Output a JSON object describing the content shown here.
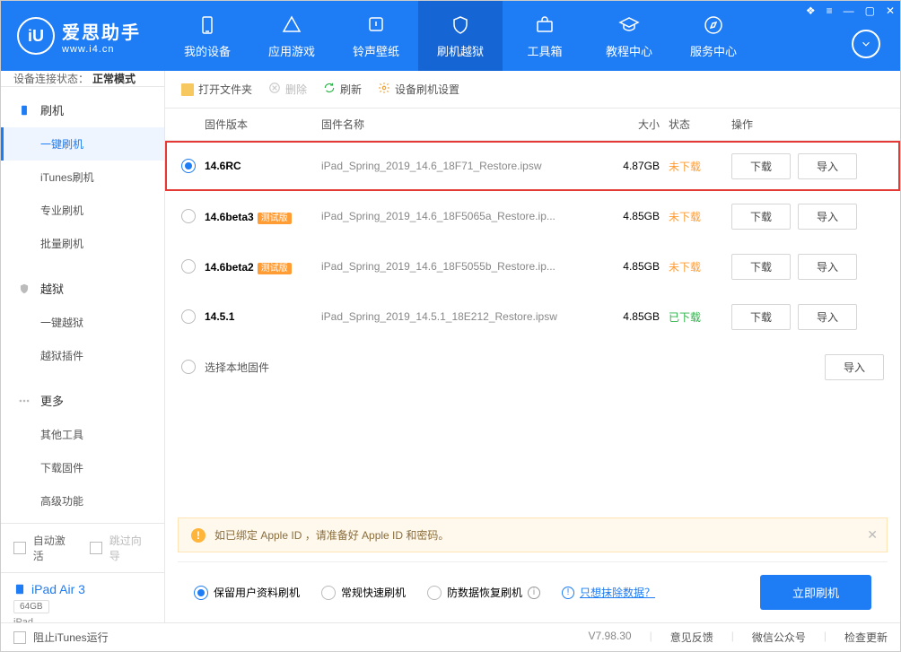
{
  "brand": {
    "name": "爱思助手",
    "url": "www.i4.cn"
  },
  "nav": {
    "items": [
      "我的设备",
      "应用游戏",
      "铃声壁纸",
      "刷机越狱",
      "工具箱",
      "教程中心",
      "服务中心"
    ]
  },
  "sidebar": {
    "status_label": "设备连接状态：",
    "status_value": "正常模式",
    "groups": {
      "flash": {
        "head": "刷机",
        "items": [
          "一键刷机",
          "iTunes刷机",
          "专业刷机",
          "批量刷机"
        ]
      },
      "jailbreak": {
        "head": "越狱",
        "items": [
          "一键越狱",
          "越狱插件"
        ]
      },
      "more": {
        "head": "更多",
        "items": [
          "其他工具",
          "下载固件",
          "高级功能"
        ]
      }
    },
    "auto_activate": "自动激活",
    "skip_wizard": "跳过向导",
    "device": {
      "name": "iPad Air 3",
      "storage": "64GB",
      "type": "iPad"
    }
  },
  "toolbar": {
    "open": "打开文件夹",
    "delete": "删除",
    "refresh": "刷新",
    "settings": "设备刷机设置"
  },
  "table": {
    "headers": {
      "version": "固件版本",
      "name": "固件名称",
      "size": "大小",
      "status": "状态",
      "action": "操作"
    },
    "rows": [
      {
        "version": "14.6RC",
        "badge": "",
        "name": "iPad_Spring_2019_14.6_18F71_Restore.ipsw",
        "size": "4.87GB",
        "status": "未下载",
        "status_class": "status-undl",
        "selected": true,
        "highlight": true,
        "dl_btn": "下载",
        "imp_btn": "导入"
      },
      {
        "version": "14.6beta3",
        "badge": "测试版",
        "name": "iPad_Spring_2019_14.6_18F5065a_Restore.ip...",
        "size": "4.85GB",
        "status": "未下载",
        "status_class": "status-undl",
        "selected": false,
        "highlight": false,
        "dl_btn": "下载",
        "imp_btn": "导入"
      },
      {
        "version": "14.6beta2",
        "badge": "测试版",
        "name": "iPad_Spring_2019_14.6_18F5055b_Restore.ip...",
        "size": "4.85GB",
        "status": "未下载",
        "status_class": "status-undl",
        "selected": false,
        "highlight": false,
        "dl_btn": "下载",
        "imp_btn": "导入"
      },
      {
        "version": "14.5.1",
        "badge": "",
        "name": "iPad_Spring_2019_14.5.1_18E212_Restore.ipsw",
        "size": "4.85GB",
        "status": "已下载",
        "status_class": "status-dl",
        "selected": false,
        "highlight": false,
        "dl_btn": "下载",
        "imp_btn": "导入"
      }
    ],
    "local_row": {
      "label": "选择本地固件",
      "imp_btn": "导入"
    }
  },
  "warning": "如已绑定 Apple ID ，请准备好 Apple ID 和密码。",
  "flash_options": {
    "keep_data": "保留用户资料刷机",
    "normal": "常规快速刷机",
    "recovery": "防数据恢复刷机",
    "erase_link": "只想抹除数据？",
    "flash_now": "立即刷机"
  },
  "footer": {
    "block_itunes": "阻止iTunes运行",
    "version": "V7.98.30",
    "feedback": "意见反馈",
    "wechat": "微信公众号",
    "update": "检查更新"
  }
}
